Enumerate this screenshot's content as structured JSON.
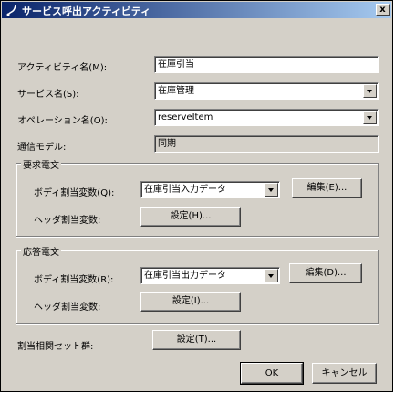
{
  "window": {
    "title": "サービス呼出アクティビティ",
    "close_label": "x"
  },
  "form": {
    "activity_name": {
      "label": "アクティビティ名(M):",
      "value": "在庫引当"
    },
    "service_name": {
      "label": "サービス名(S):",
      "value": "在庫管理"
    },
    "operation_name": {
      "label": "オペレーション名(O):",
      "value": "reserveItem"
    },
    "comm_model": {
      "label": "通信モデル:",
      "value": "同期"
    }
  },
  "request_group": {
    "title": "要求電文",
    "body_label": "ボディ割当変数(Q):",
    "body_value": "在庫引当入力データ",
    "edit_button": "編集(E)...",
    "header_label": "ヘッダ割当変数:",
    "header_button": "設定(H)..."
  },
  "response_group": {
    "title": "応答電文",
    "body_label": "ボディ割当変数(R):",
    "body_value": "在庫引当出力データ",
    "edit_button": "編集(D)...",
    "header_label": "ヘッダ割当変数:",
    "header_button": "設定(I)..."
  },
  "correlation": {
    "label": "割当相関セット群:",
    "button": "設定(T)..."
  },
  "footer": {
    "ok": "OK",
    "cancel": "キャンセル"
  }
}
